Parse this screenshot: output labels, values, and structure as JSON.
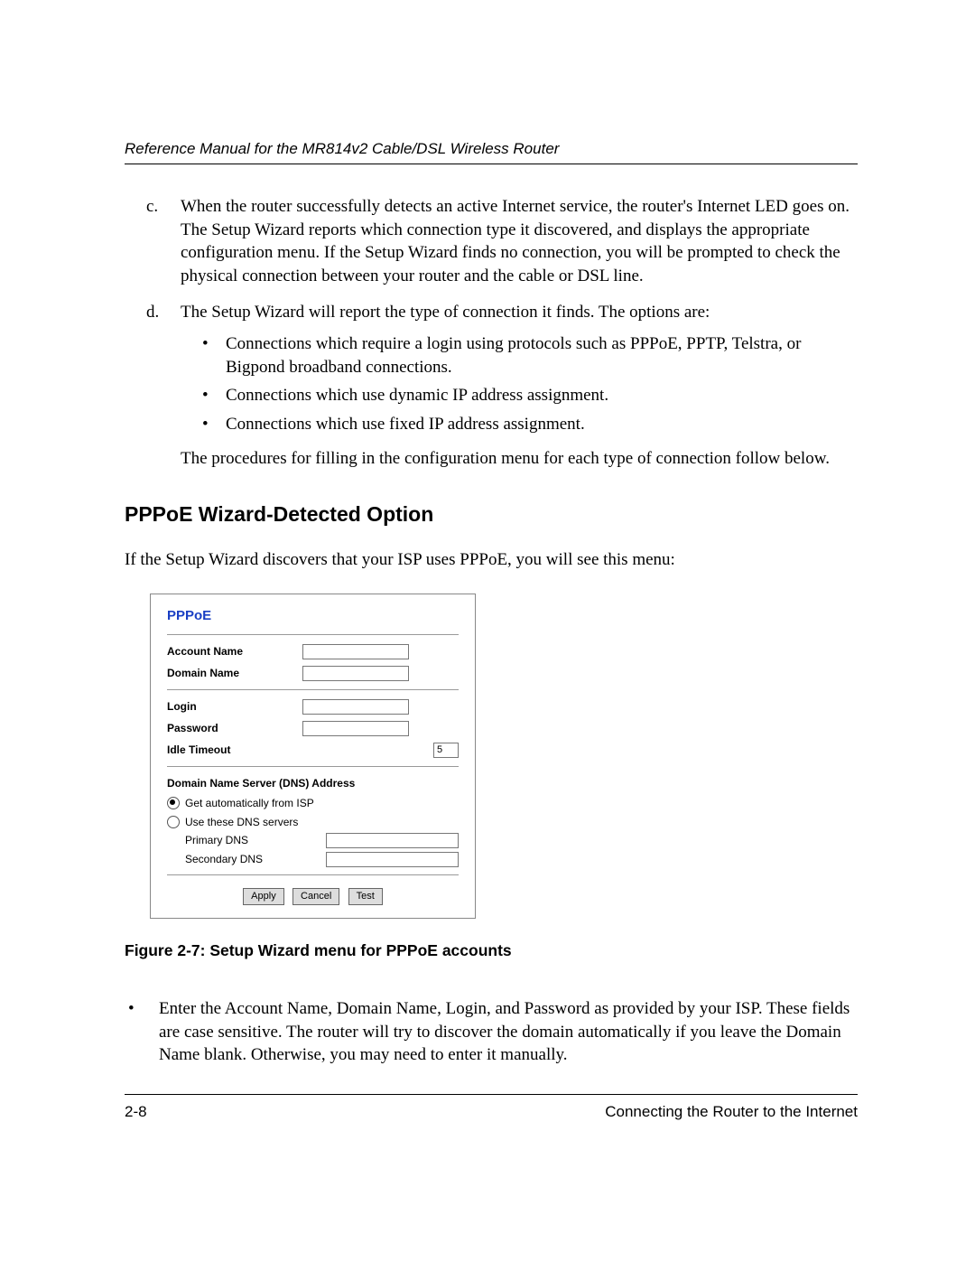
{
  "header": {
    "running": "Reference Manual for the MR814v2 Cable/DSL Wireless Router"
  },
  "list": {
    "c_marker": "c.",
    "c_text": "When the router successfully detects an active Internet service, the router's Internet LED goes on. The Setup Wizard reports which connection type it discovered, and displays the appropriate configuration menu. If the Setup Wizard finds no connection, you will be prompted to check the physical connection between your router and the cable or DSL line.",
    "d_marker": "d.",
    "d_text": "The Setup Wizard will report the type of connection it finds. The options are:",
    "d_bullets": [
      "Connections which require a login using protocols such as PPPoE, PPTP, Telstra, or Bigpond broadband connections.",
      "Connections which use dynamic IP address assignment.",
      "Connections which use fixed IP address assignment."
    ],
    "d_followup": "The procedures for filling in the configuration menu for each type of connection follow below."
  },
  "section": {
    "heading": "PPPoE Wizard-Detected Option",
    "intro": "If the Setup Wizard discovers that your ISP uses PPPoE, you will see this menu:"
  },
  "pppoe": {
    "title": "PPPoE",
    "account_name_label": "Account Name",
    "domain_name_label": "Domain Name",
    "login_label": "Login",
    "password_label": "Password",
    "idle_timeout_label": "Idle Timeout",
    "idle_timeout_value": "5",
    "dns_heading": "Domain Name Server (DNS) Address",
    "dns_auto": "Get automatically from ISP",
    "dns_use": "Use these DNS servers",
    "primary_dns": "Primary DNS",
    "secondary_dns": "Secondary DNS",
    "apply": "Apply",
    "cancel": "Cancel",
    "test": "Test"
  },
  "figure": {
    "caption": "Figure 2-7:  Setup Wizard menu for PPPoE accounts"
  },
  "instructions": {
    "item1": "Enter the Account Name, Domain Name, Login, and Password as provided by your ISP. These fields are case sensitive. The router will try to discover the domain automatically if you leave the Domain Name blank. Otherwise, you may need to enter it manually."
  },
  "footer": {
    "page_num": "2-8",
    "chapter": "Connecting the Router to the Internet"
  }
}
